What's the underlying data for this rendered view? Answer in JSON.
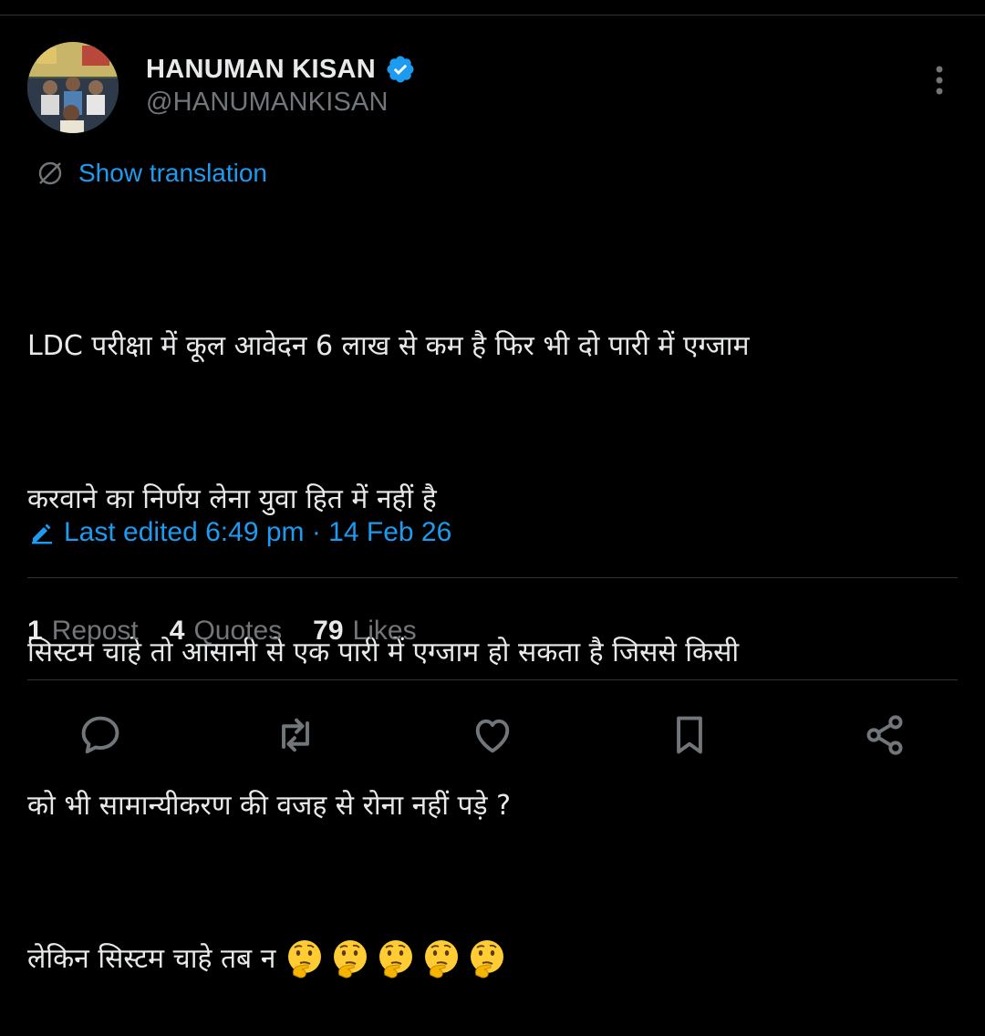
{
  "author": {
    "display_name": "HANUMAN KISAN",
    "handle": "@HANUMANKISAN",
    "verified": true
  },
  "translate": {
    "label": "Show translation",
    "icon": "translate-globe-icon"
  },
  "tweet": {
    "lines": [
      "LDC परीक्षा में कूल आवेदन 6 लाख से कम है फिर भी दो पारी में एग्जाम",
      "करवाने का निर्णय लेना युवा हित में नहीं है",
      "सिस्टम चाहे तो आसानी से एक पारी में एग्जाम हो सकता है जिससे किसी",
      "को भी सामान्यीकरण की वजह से रोना नहीं पड़े ?",
      "लेकिन सिस्टम चाहे तब न "
    ],
    "emoji_count": 5,
    "emoji_icon": "thinking-face-emoji"
  },
  "edited": {
    "label": "Last edited 6:49 pm · 14 Feb 26",
    "icon": "pencil-icon"
  },
  "stats": {
    "reposts": {
      "count": "1",
      "label": "Repost"
    },
    "quotes": {
      "count": "4",
      "label": "Quotes"
    },
    "likes": {
      "count": "79",
      "label": "Likes"
    }
  },
  "actions": [
    "reply-icon",
    "repost-icon",
    "like-icon",
    "bookmark-icon",
    "share-icon"
  ],
  "colors": {
    "background": "#000000",
    "text": "#e7e9ea",
    "muted": "#71767b",
    "accent": "#1d9bf0",
    "divider": "#2f3336"
  }
}
